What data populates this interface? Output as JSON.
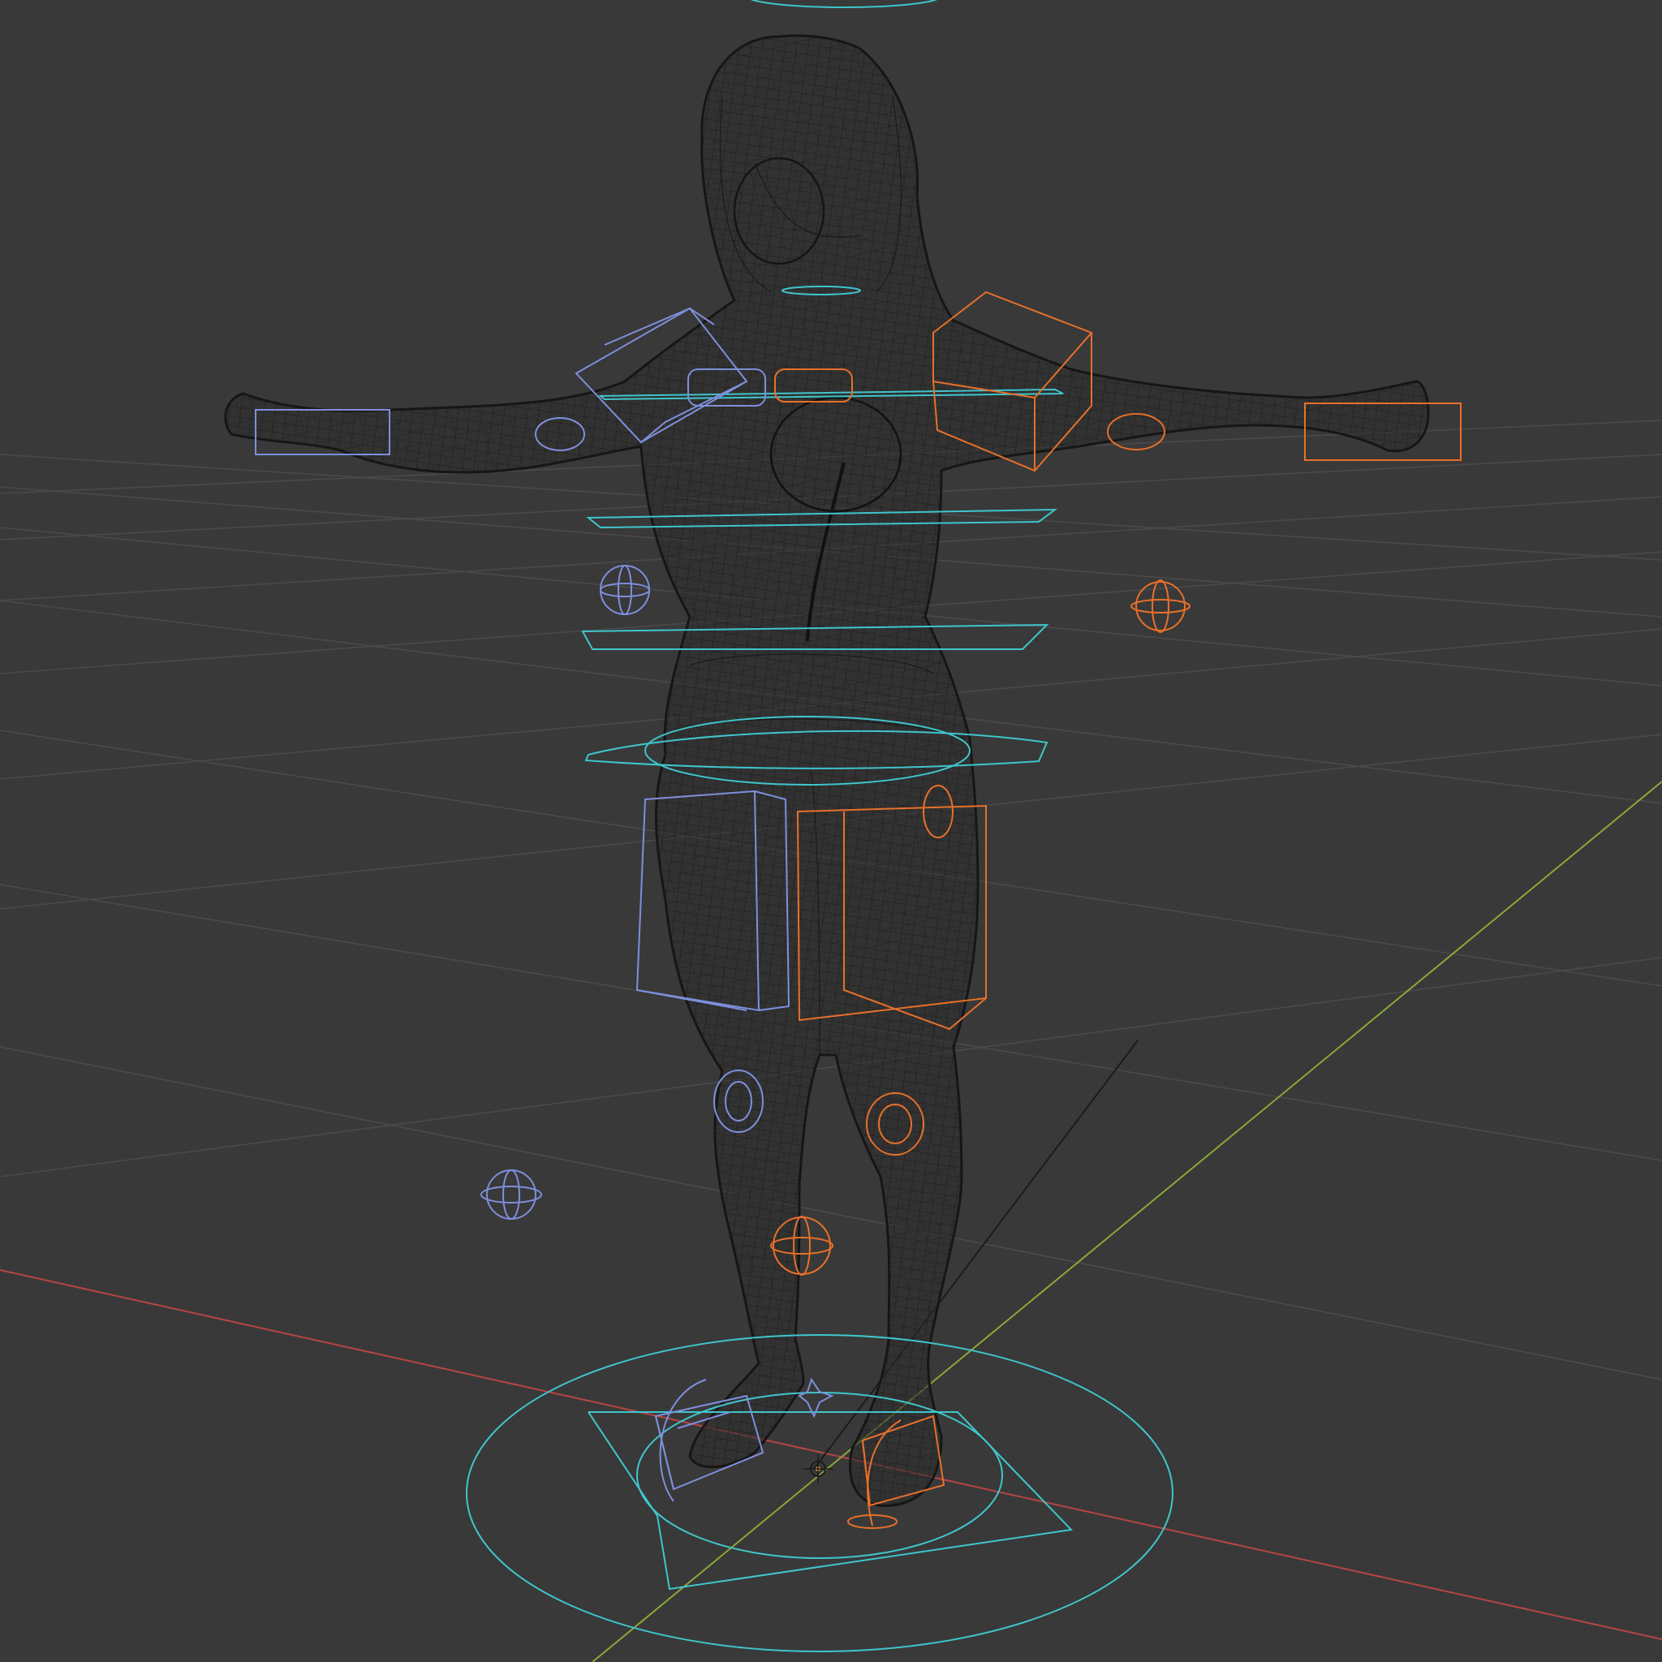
{
  "viewport": {
    "background": "#393939",
    "grid_color": "#4a4a4a",
    "axis_x_color": "#b84545",
    "axis_y_color": "#8aa838",
    "axis_z_color": "#1c1c1c"
  },
  "scene": {
    "mesh": {
      "display": "wireframe",
      "wire_color": "#141414"
    },
    "rig_controls": {
      "left_side_color": "#7f8fdc",
      "right_side_color": "#e8702a",
      "center_color": "#3fc6cc"
    },
    "origin_marker_color": "#f0a030"
  }
}
